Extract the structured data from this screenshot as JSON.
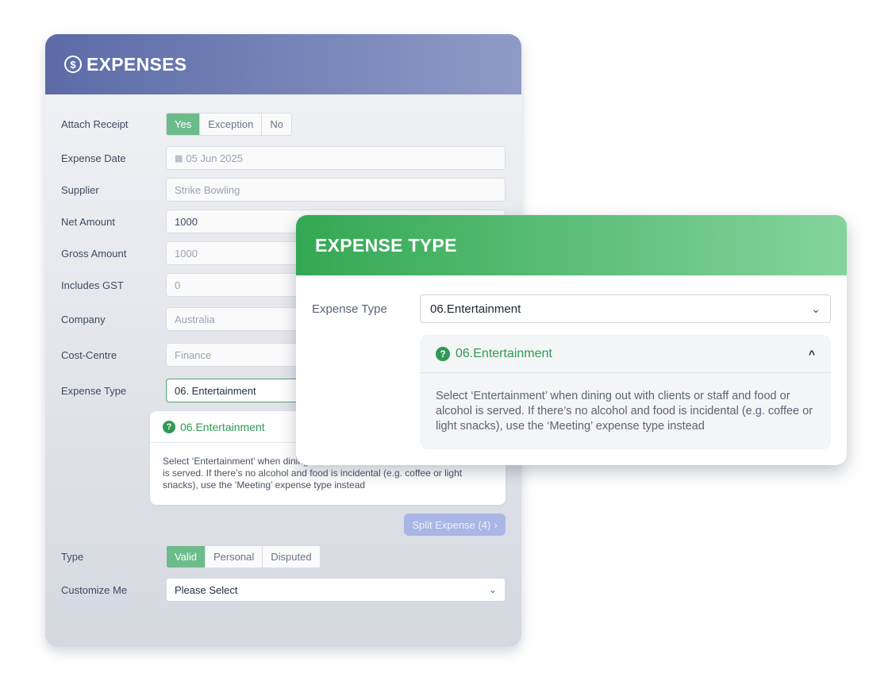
{
  "expenses": {
    "title": "EXPENSES",
    "header_icon": "dollar-circle-icon",
    "attach_receipt": {
      "label": "Attach Receipt",
      "options": [
        "Yes",
        "Exception",
        "No"
      ],
      "selected": "Yes"
    },
    "expense_date": {
      "label": "Expense Date",
      "value": "05 Jun 2025"
    },
    "supplier": {
      "label": "Supplier",
      "value": "Strike Bowling"
    },
    "net_amount": {
      "label": "Net Amount",
      "value": "1000"
    },
    "gross_amount": {
      "label": "Gross Amount",
      "value": "1000"
    },
    "includes_gst": {
      "label": "Includes GST",
      "value": "0"
    },
    "company": {
      "label": "Company",
      "value": "Australia"
    },
    "cost_centre": {
      "label": "Cost-Centre",
      "value": "Finance"
    },
    "expense_type": {
      "label": "Expense Type",
      "value": "06. Entertainment"
    },
    "info": {
      "title": "06.Entertainment",
      "text": "Select ‘Entertainment’ when dining out with clients or staff and food or alcohol is served. If there’s no alcohol and food is incidental (e.g. coffee or light snacks), use the ‘Meeting’ expense type instead"
    },
    "split_button": "Split Expense (4)",
    "type": {
      "label": "Type",
      "options": [
        "Valid",
        "Personal",
        "Disputed"
      ],
      "selected": "Valid"
    },
    "customize": {
      "label": "Customize Me",
      "value": "Please Select"
    }
  },
  "overlay": {
    "title": "EXPENSE TYPE",
    "label": "Expense Type",
    "select_value": "06.Entertainment",
    "info_title": "06.Entertainment",
    "info_text": "Select ‘Entertainment’ when dining out with clients or staff and food or alcohol is served. If there’s no alcohol and food is incidental (e.g. coffee or light snacks), use the ‘Meeting’ expense type instead"
  },
  "colors": {
    "main_header_start": "#5c6ba7",
    "main_header_end": "#8f9ac7",
    "overlay_header_start": "#34a853",
    "overlay_header_end": "#84d49d",
    "selected_segment": "#6cbc8b",
    "info_green": "#2f9a52",
    "split_button": "#a9b6e6"
  }
}
